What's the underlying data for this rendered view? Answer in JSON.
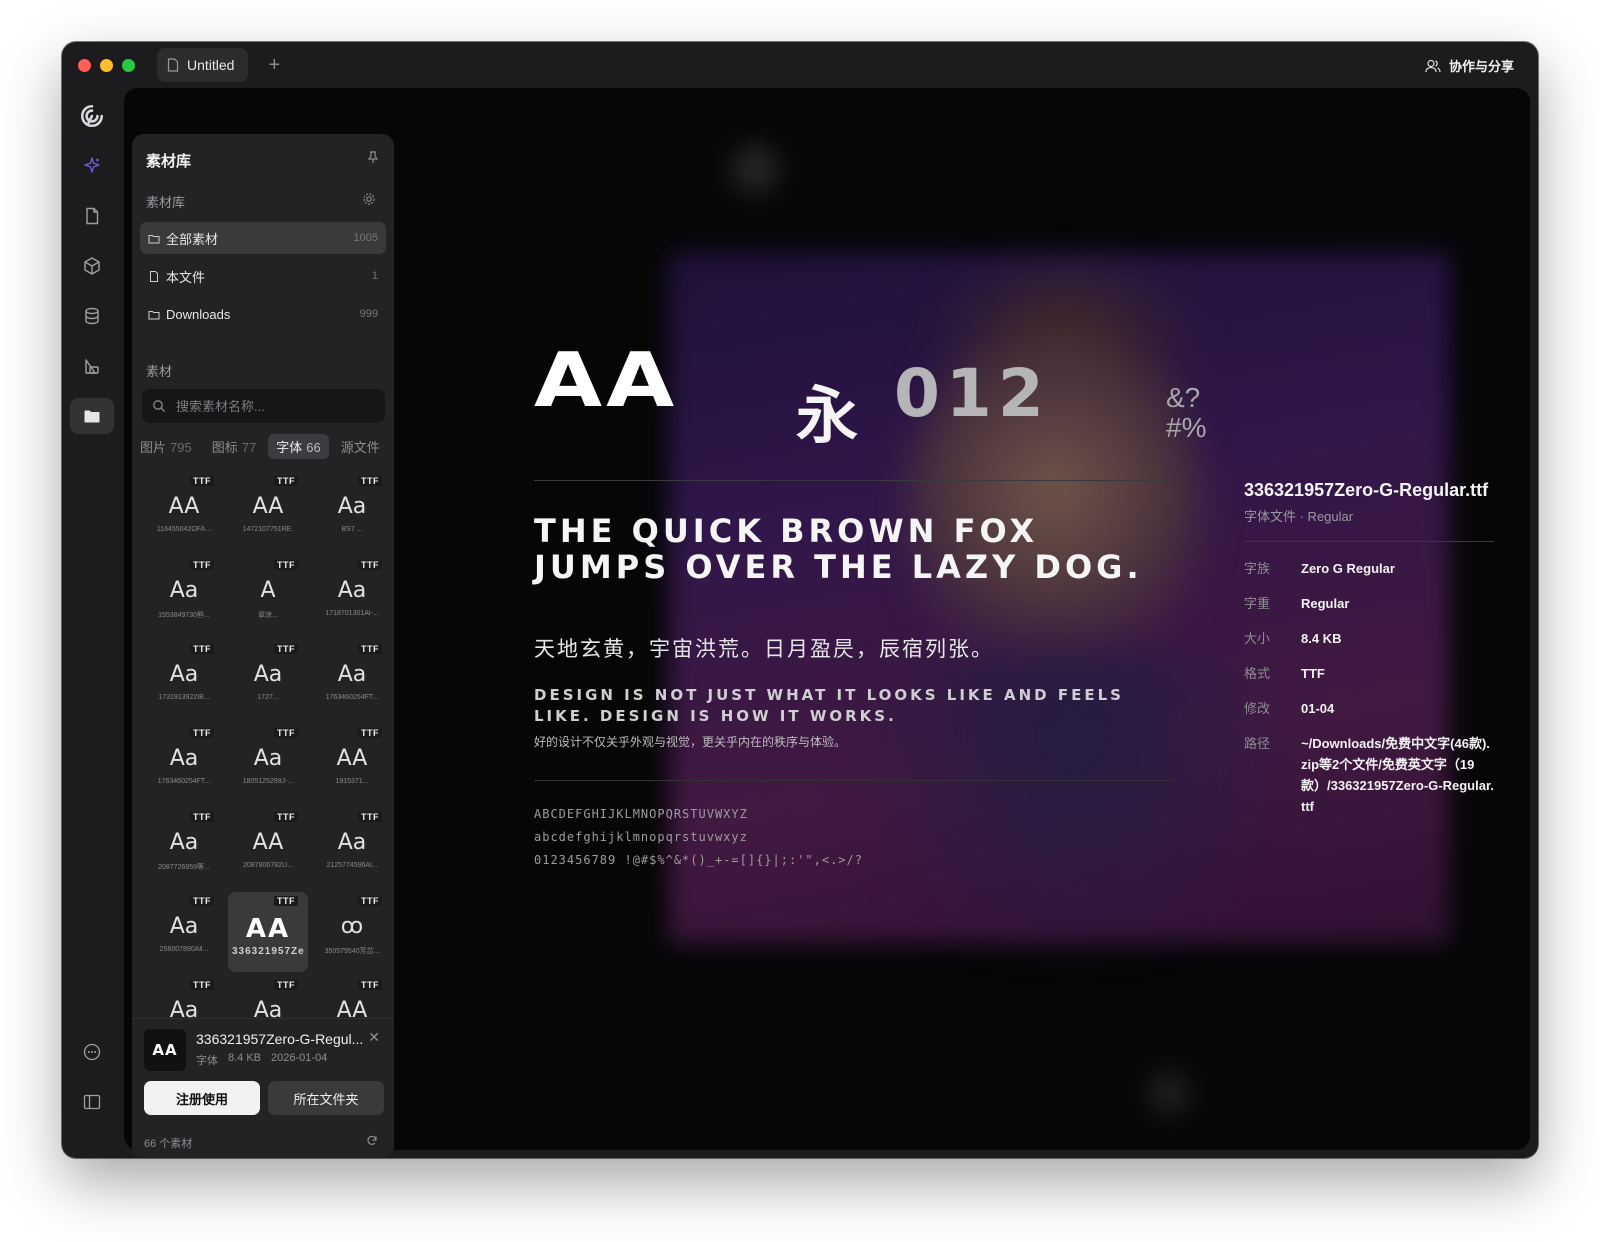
{
  "window": {
    "tab_title": "Untitled",
    "share_label": "协作与分享"
  },
  "panel": {
    "title": "素材库",
    "library_label": "素材库",
    "libraries": [
      {
        "name": "全部素材",
        "count": "1005"
      },
      {
        "name": "本文件",
        "count": "1"
      },
      {
        "name": "Downloads",
        "count": "999"
      }
    ],
    "materials_label": "素材",
    "search_placeholder": "搜索素材名称...",
    "filters": [
      {
        "label": "图片",
        "count": "795"
      },
      {
        "label": "图标",
        "count": "77"
      },
      {
        "label": "字体",
        "count": "66"
      },
      {
        "label": "源文件",
        "count": ""
      }
    ],
    "badge": "TTF",
    "fonts": [
      {
        "glyph": "AA",
        "name": "116455042OFA..."
      },
      {
        "glyph": "AA",
        "name": "1472107751RE."
      },
      {
        "glyph": "Aa",
        "name": "BS7 ..."
      },
      {
        "glyph": "Aa",
        "name": "1553849730熊..."
      },
      {
        "glyph": "A",
        "name": "翠凉..."
      },
      {
        "glyph": "Aa",
        "name": "1718701301Al-..."
      },
      {
        "glyph": "Aa",
        "name": "1731913922IB..."
      },
      {
        "glyph": "Aa",
        "name": "1727..."
      },
      {
        "glyph": "Aa",
        "name": "1763460254FT..."
      },
      {
        "glyph": "Aa",
        "name": "1763460254FT..."
      },
      {
        "glyph": "Aa",
        "name": "1805125299J-..."
      },
      {
        "glyph": "AA",
        "name": "1915371..."
      },
      {
        "glyph": "Aa",
        "name": "2087726959等..."
      },
      {
        "glyph": "AA",
        "name": "2087806782U..."
      },
      {
        "glyph": "Aa",
        "name": "2125774596Al..."
      },
      {
        "glyph": "Aa",
        "name": "256007890All..."
      },
      {
        "glyph": "AA",
        "name": "336321957Ze"
      },
      {
        "glyph": "ꝏ",
        "name": "350579540芳芯..."
      },
      {
        "glyph": "Aa",
        "name": ""
      },
      {
        "glyph": "Aa",
        "name": ""
      },
      {
        "glyph": "AA",
        "name": ""
      }
    ],
    "selected": {
      "thumb": "AA",
      "name": "336321957Zero-G-Regul...",
      "type": "字体",
      "size": "8.4 KB",
      "date": "2026-01-04"
    },
    "primary_button": "注册使用",
    "secondary_button": "所在文件夹",
    "footer_count": "66 个素材"
  },
  "preview": {
    "big_latin": "AA",
    "big_cjk": "永",
    "big_digits": "012",
    "big_symbols": "&? #%",
    "pangram": "The quick brown fox jumps over the lazy dog.",
    "cjk_sample": "天地玄黄，宇宙洪荒。日月盈昃，辰宿列张。",
    "quote": "Design is not just what it looks like and feels like. Design is how it works.",
    "quote_cn": "好的设计不仅关乎外观与视觉，更关乎内在的秩序与体验。",
    "uppercase": "ABCDEFGHIJKLMNOPQRSTUVWXYZ",
    "lowercase": "abcdefghijklmnopqrstuvwxyz",
    "digits_symbols": "0123456789 !@#$%^&*()_+-=[]{}|;:'\",<.>/?"
  },
  "info": {
    "title": "336321957Zero-G-Regular.ttf",
    "subtitle": "字体文件 · Regular",
    "rows": [
      {
        "key": "字族",
        "value": "Zero G Regular"
      },
      {
        "key": "字重",
        "value": "Regular"
      },
      {
        "key": "大小",
        "value": "8.4 KB"
      },
      {
        "key": "格式",
        "value": "TTF"
      },
      {
        "key": "修改",
        "value": "01-04"
      },
      {
        "key": "路径",
        "value": "~/Downloads/免费中文字(46款).zip等2个文件/免费英文字（19款）/336321957Zero-G-Regular.ttf"
      }
    ]
  },
  "colors": {
    "window_bg": "#1c1c1e",
    "panel_bg": "#232326",
    "accent_purple": "#6e5bd8",
    "close": "#ff5f57",
    "minimize": "#febc2e",
    "zoom": "#28c840"
  }
}
